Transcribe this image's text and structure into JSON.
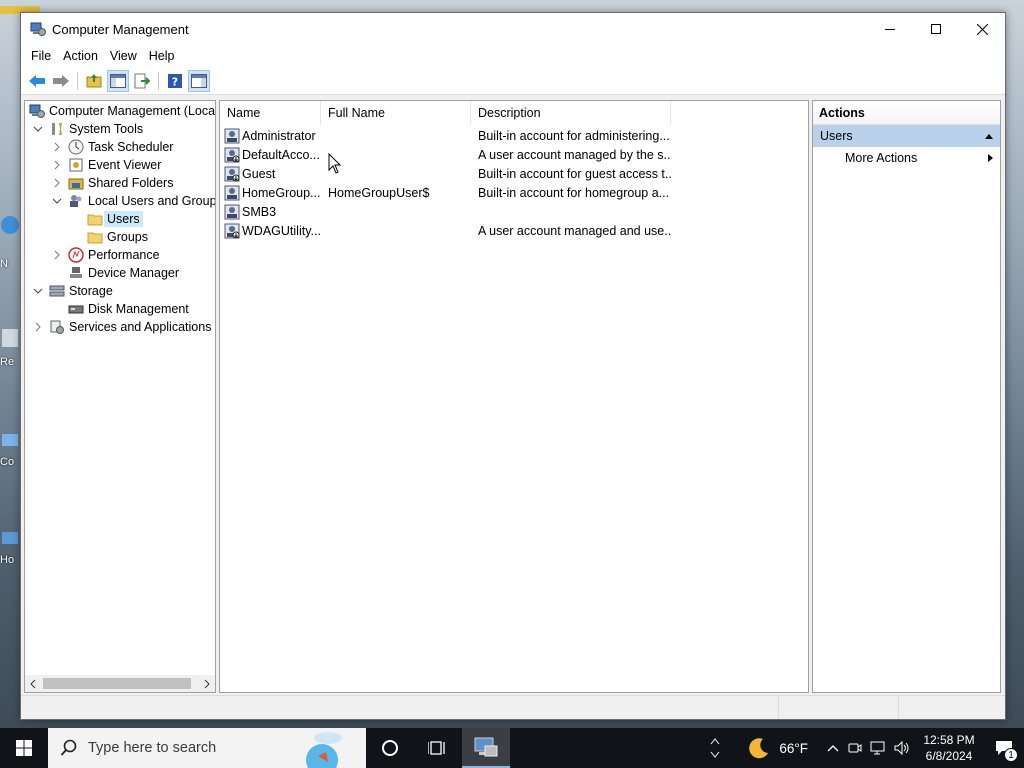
{
  "window": {
    "title": "Computer Management",
    "controls": [
      "minimize",
      "maximize",
      "close"
    ]
  },
  "menu": [
    "File",
    "Action",
    "View",
    "Help"
  ],
  "toolbar": {
    "icons": [
      "back-arrow-icon",
      "forward-arrow-icon",
      "up-folder-icon",
      "show-hide-console-tree-icon",
      "export-list-icon",
      "help-icon",
      "show-hide-action-pane-icon"
    ]
  },
  "tree": {
    "items": [
      {
        "label": "Computer Management (Local",
        "icon": "computer-management-icon"
      },
      {
        "label": "System Tools",
        "icon": "tools-icon"
      },
      {
        "label": "Task Scheduler",
        "icon": "clock-icon"
      },
      {
        "label": "Event Viewer",
        "icon": "event-viewer-icon"
      },
      {
        "label": "Shared Folders",
        "icon": "shared-folder-icon"
      },
      {
        "label": "Local Users and Groups",
        "icon": "users-groups-icon"
      },
      {
        "label": "Users",
        "icon": "folder-icon"
      },
      {
        "label": "Groups",
        "icon": "folder-icon"
      },
      {
        "label": "Performance",
        "icon": "performance-icon"
      },
      {
        "label": "Device Manager",
        "icon": "device-manager-icon"
      },
      {
        "label": "Storage",
        "icon": "storage-icon"
      },
      {
        "label": "Disk Management",
        "icon": "disk-icon"
      },
      {
        "label": "Services and Applications",
        "icon": "services-icon"
      }
    ],
    "selected": "Users"
  },
  "list": {
    "columns": [
      "Name",
      "Full Name",
      "Description"
    ],
    "rows": [
      {
        "name": "Administrator",
        "full_name": "",
        "description": "Built-in account for administering..."
      },
      {
        "name": "DefaultAcco...",
        "full_name": "",
        "description": "A user account managed by the s..."
      },
      {
        "name": "Guest",
        "full_name": "",
        "description": "Built-in account for guest access t..."
      },
      {
        "name": "HomeGroup...",
        "full_name": "HomeGroupUser$",
        "description": "Built-in account for homegroup a..."
      },
      {
        "name": "SMB3",
        "full_name": "",
        "description": ""
      },
      {
        "name": "WDAGUtility...",
        "full_name": "",
        "description": "A user account managed and use..."
      }
    ]
  },
  "actions": {
    "header": "Actions",
    "section": "Users",
    "items": [
      "More Actions"
    ]
  },
  "taskbar": {
    "search_placeholder": "Type here to search",
    "weather": "66°F",
    "time": "12:58 PM",
    "date": "6/8/2024",
    "notification_count": "1"
  },
  "desktop_fragments": [
    "N",
    "Re",
    "Co",
    "Ho"
  ]
}
